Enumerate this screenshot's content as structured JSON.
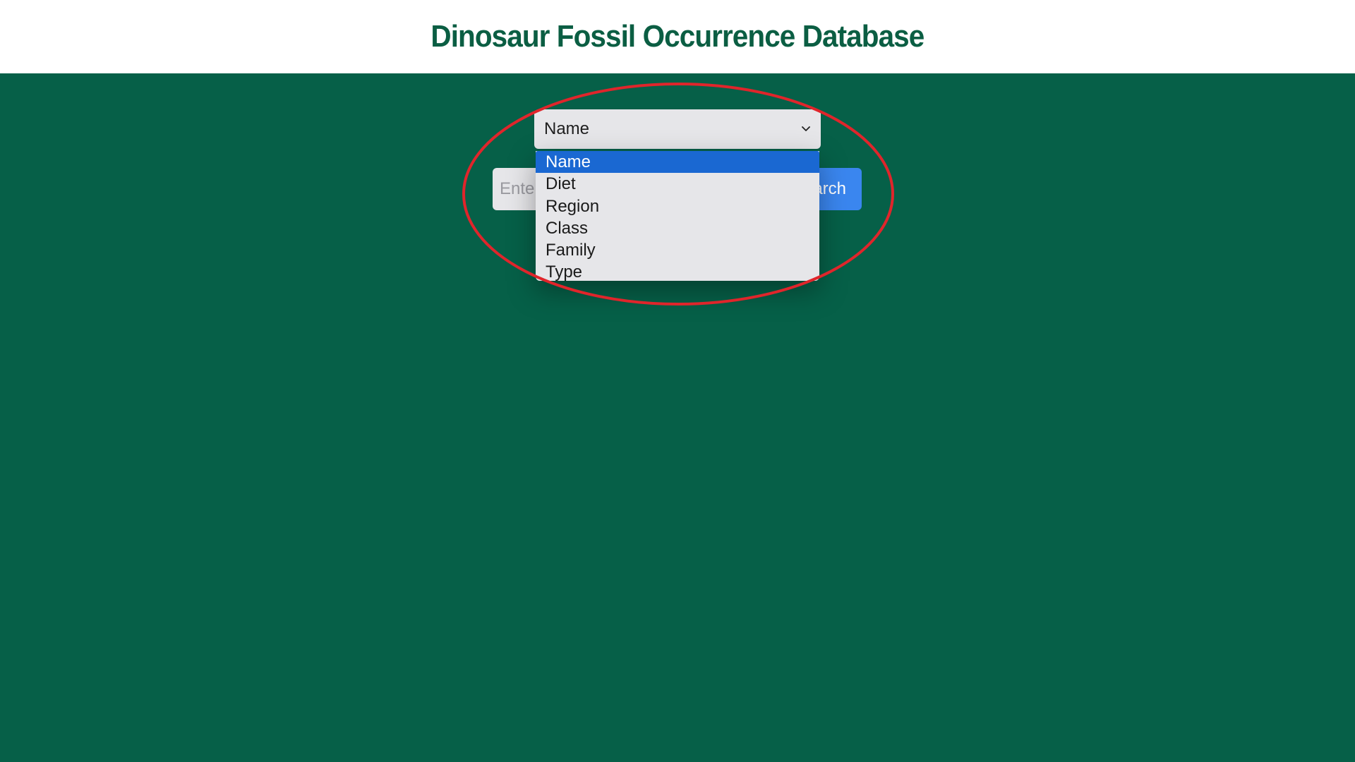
{
  "header": {
    "title": "Dinosaur Fossil Occurrence Database"
  },
  "search": {
    "select_value": "Name",
    "options": [
      "Name",
      "Diet",
      "Region",
      "Class",
      "Family",
      "Type"
    ],
    "selected_index": 0,
    "input_placeholder": "Enter",
    "button_label": "arch"
  },
  "colors": {
    "header_title": "#0b5e43",
    "background": "#066048",
    "option_highlight": "#1a68d2",
    "button": "#3a86ef",
    "annotation": "#e0252b"
  },
  "icons": {
    "select_arrow": "chevron-down-icon"
  }
}
